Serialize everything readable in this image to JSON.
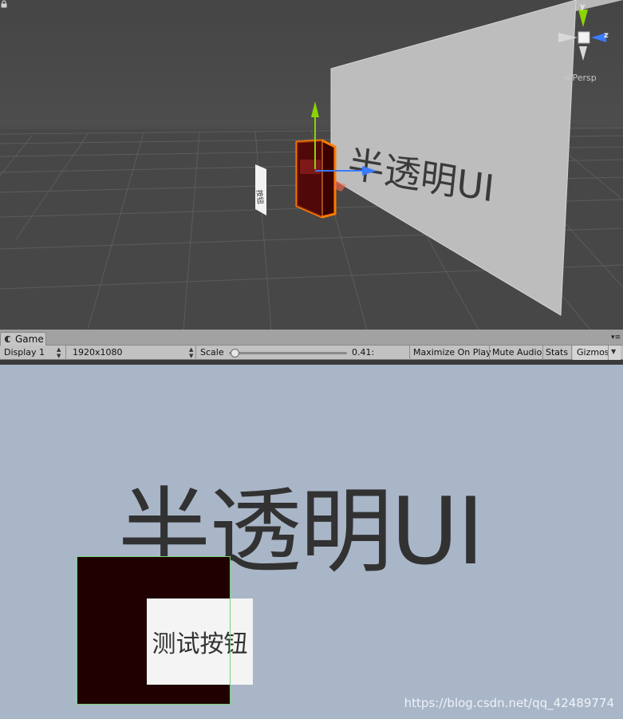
{
  "scene": {
    "plane_text": "半透明UI",
    "gizmo": {
      "y_axis": "y",
      "z_axis": "z",
      "projection_label": "Persp"
    }
  },
  "tab_bar": {
    "game_tab_label": "Game",
    "menu_glyph": "▾≡"
  },
  "toolbar": {
    "display": "Display 1",
    "resolution": "1920x1080",
    "scale_label": "Scale",
    "scale_value_text": "0.41:",
    "scale_fraction": 0.05,
    "maximize_on_play": "Maximize On Play",
    "mute_audio": "Mute Audio",
    "stats": "Stats",
    "gizmos": "Gizmos"
  },
  "game_view": {
    "title": "半透明UI",
    "button_label": "测试按钮",
    "background_color": "#a9b6c8",
    "panel_color": "#200000",
    "watermark": "https://blog.csdn.net/qq_42489774"
  },
  "colors": {
    "scene_bg": "#474747",
    "selection_outline": "#ff7a00",
    "axis_x": "#3a7bff",
    "axis_y": "#8cd400"
  },
  "icons": {
    "game_tab": "game-controller-icon",
    "lock": "lock-icon",
    "scene_gizmo": "orientation-gizmo-icon"
  }
}
